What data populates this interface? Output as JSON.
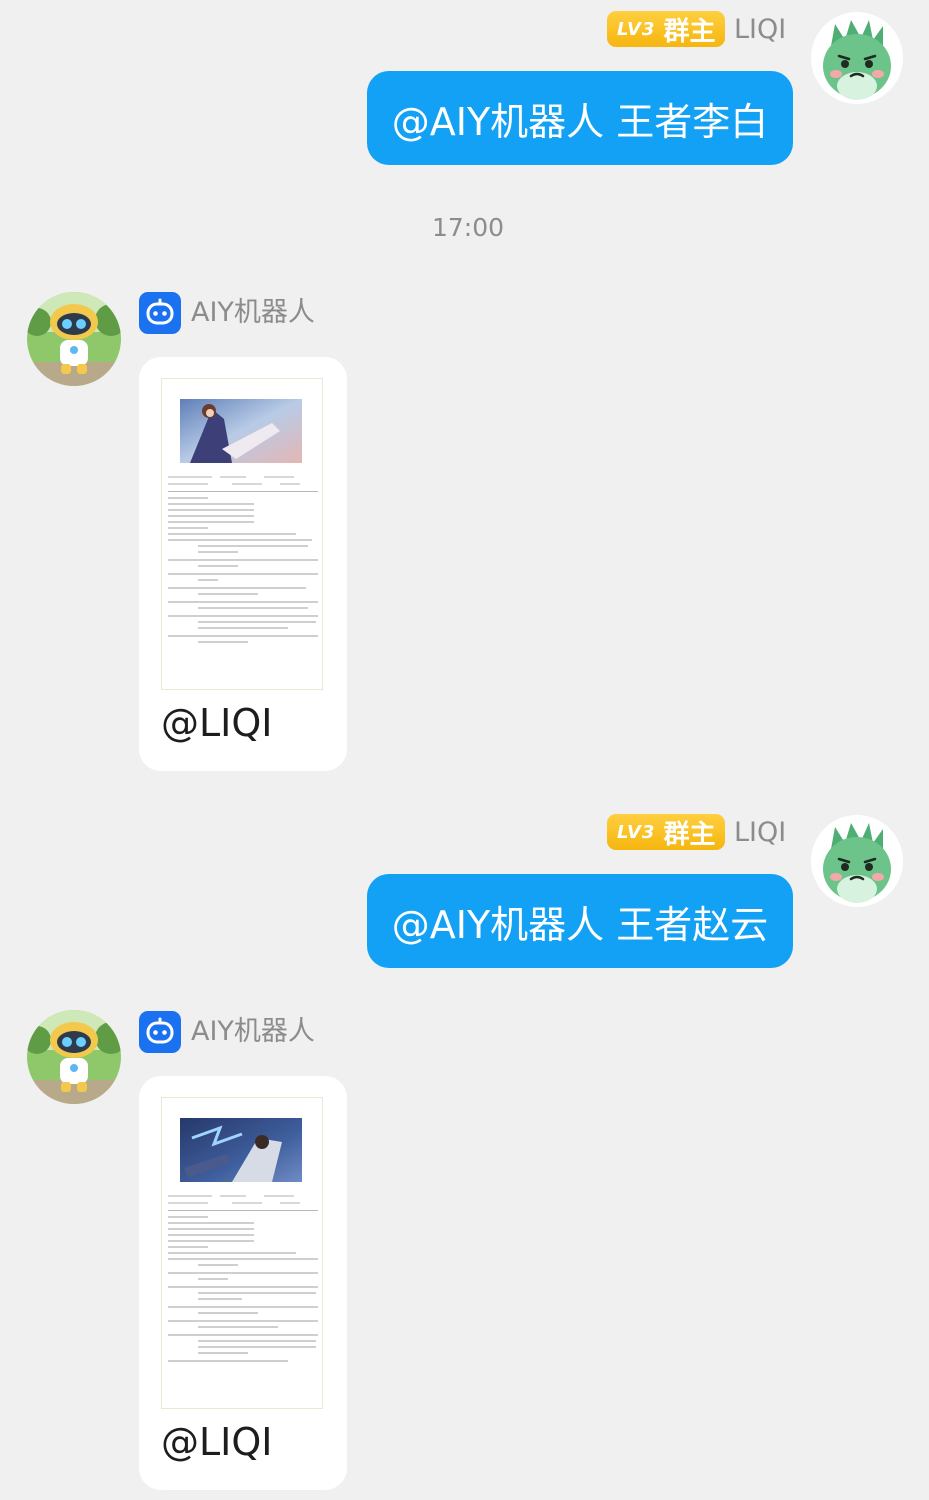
{
  "messages": [
    {
      "sender": "user",
      "badge_level": "LV3",
      "badge_role": "群主",
      "name": "LIQI",
      "text": "@AIY机器人 王者李白"
    },
    {
      "sender": "bot",
      "name": "AIY机器人",
      "card_mention": "@LIQI"
    },
    {
      "sender": "user",
      "badge_level": "LV3",
      "badge_role": "群主",
      "name": "LIQI",
      "text": "@AIY机器人 王者赵云"
    },
    {
      "sender": "bot",
      "name": "AIY机器人",
      "card_mention": "@LIQI"
    }
  ],
  "timestamp": "17:00",
  "colors": {
    "background": "#f0f0f0",
    "user_bubble": "#12a1f5",
    "badge": "#f5b60f",
    "bot_icon": "#1b72f1",
    "name_text": "#8c8c8c"
  }
}
